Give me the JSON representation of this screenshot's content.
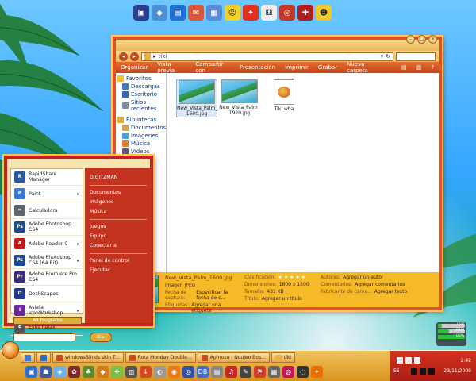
{
  "explorer": {
    "address_path": "tiki",
    "toolbar": [
      "Organizar",
      "Vista previa",
      "Compartir con",
      "Presentación",
      "Imprimir",
      "Grabar",
      "Nueva carpeta"
    ],
    "nav": {
      "favorites_head": "Favoritos",
      "favorites": [
        "Descargas",
        "Escritorio",
        "Sitios recientes"
      ],
      "libraries_head": "Bibliotecas",
      "libraries": [
        "Documentos",
        "Imágenes",
        "Música",
        "Vídeos"
      ]
    },
    "files": [
      {
        "name": "New_Vista_Palm_1600.jpg",
        "line1": "New_Vista_Palm_",
        "line2": "1600.jpg"
      },
      {
        "name": "New_Vista_Palm_1920.jpg",
        "line1": "New_Vista_Palm_",
        "line2": "1920.jpg"
      },
      {
        "name": "Tiki.wba",
        "line1": "Tiki.wba",
        "line2": ""
      }
    ],
    "details": {
      "filename": "New_Vista_Palm_1600.jpg",
      "filetype": "Imagen JPEG",
      "date_k": "Fecha de captura:",
      "date_v": "Especificar la fecha de c...",
      "tags_k": "Etiquetas:",
      "tags_v": "Agregar una etiqueta",
      "rating_k": "Clasificación:",
      "rating_v": "★ ★ ★ ★ ★",
      "dims_k": "Dimensiones:",
      "dims_v": "1600 x 1200",
      "size_k": "Tamaño:",
      "size_v": "431 KB",
      "title_k": "Título:",
      "title_v": "Agregar un título",
      "authors_k": "Autores:",
      "authors_v": "Agregar un autor",
      "comments_k": "Comentarios:",
      "comments_v": "Agregar comentarios",
      "maker_k": "Fabricante de cáma...",
      "maker_v": "Agregar texto"
    }
  },
  "start_menu": {
    "programs": [
      {
        "label": "RapidShare Manager",
        "icon_name": "rapidshare-icon",
        "color": "#2c5aa0",
        "glyph": "R",
        "arrow": ""
      },
      {
        "label": "Paint",
        "icon_name": "paint-icon",
        "color": "#3a7bd5",
        "glyph": "P",
        "arrow": "▸"
      },
      {
        "label": "Calculadora",
        "icon_name": "calculator-icon",
        "color": "#5b6770",
        "glyph": "=",
        "arrow": ""
      },
      {
        "label": "Adobe Photoshop CS4",
        "icon_name": "photoshop-icon",
        "color": "#1b4e8f",
        "glyph": "Ps",
        "arrow": ""
      },
      {
        "label": "Adobe Reader 9",
        "icon_name": "adobe-reader-icon",
        "color": "#c11a1a",
        "glyph": "A",
        "arrow": "▸"
      },
      {
        "label": "Adobe Photoshop CS4 (64 Bit)",
        "icon_name": "photoshop-64-icon",
        "color": "#1b4e8f",
        "glyph": "Ps",
        "arrow": "▸"
      },
      {
        "label": "Adobe Premiere Pro CS4",
        "icon_name": "premiere-icon",
        "color": "#3c2a7a",
        "glyph": "Pr",
        "arrow": ""
      },
      {
        "label": "DeskScapes",
        "icon_name": "deskscapes-icon",
        "color": "#223a8a",
        "glyph": "D",
        "arrow": ""
      },
      {
        "label": "Asiafa IconWorkshop",
        "icon_name": "iconworkshop-icon",
        "color": "#6a2a9a",
        "glyph": "I",
        "arrow": "▸"
      },
      {
        "label": "Eyes Relax",
        "icon_name": "eyes-relax-icon",
        "color": "#555555",
        "glyph": "E",
        "arrow": ""
      }
    ],
    "all_programs": "All Programs",
    "right": [
      "DIGITZMAN",
      "Documentos",
      "Imágenes",
      "Música",
      "Juegos",
      "Equipo",
      "Conectar a",
      "Panel de control",
      "Ejecutar..."
    ]
  },
  "taskbar": {
    "tasks": [
      "windowsBlinds skin T...",
      "Rota Monday Double...",
      "Aphroza - Noujeo Bos...",
      "tiki"
    ],
    "lang": "ES",
    "time": "2:42",
    "date": "23/11/2009"
  },
  "gadget": {
    "cpu_label": "CPU",
    "cpu_pct": 0.15,
    "ram_label": "RAM",
    "ram_pct": 0.42,
    "batt_label": "100%",
    "batt_pct": 1.0
  }
}
